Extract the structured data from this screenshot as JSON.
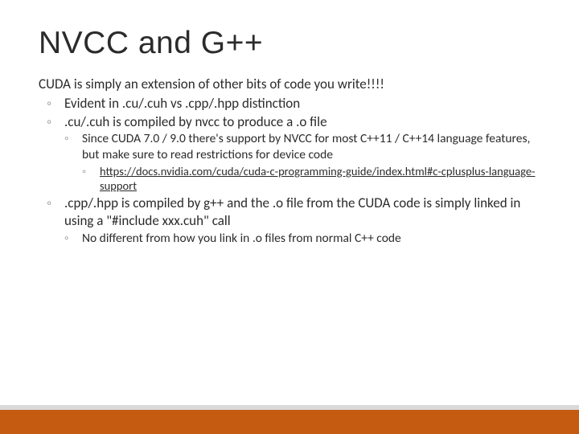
{
  "title": "NVCC and G++",
  "body": {
    "intro": "CUDA is simply an extension of other bits of code you write!!!!",
    "b1": "Evident in .cu/.cuh vs .cpp/.hpp distinction",
    "b2": ".cu/.cuh is compiled by nvcc to produce a .o file",
    "b2a": "Since CUDA 7.0 / 9.0 there's support by NVCC for most C++11 / C++14 language features, but make sure to read restrictions for device code",
    "b2a_link": "https://docs.nvidia.com/cuda/cuda-c-programming-guide/index.html#c-cplusplus-language-support",
    "b3": ".cpp/.hpp is compiled by g++ and the .o file from the CUDA code is simply linked in using a \"#include xxx.cuh\" call",
    "b3a": "No different from how you link in .o files from normal C++ code"
  },
  "glyph": "◦"
}
